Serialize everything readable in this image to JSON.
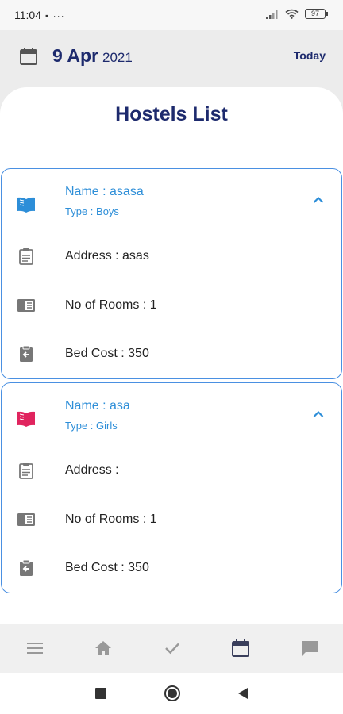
{
  "status_bar": {
    "time": "11:04",
    "left_icons": "▪ ···",
    "battery": "97"
  },
  "header": {
    "date_day": "9 Apr",
    "date_year": "2021",
    "today_label": "Today"
  },
  "page": {
    "title": "Hostels List"
  },
  "hostels": [
    {
      "name": "Name  : asasa",
      "type": "Type : Boys",
      "address": "Address : asas",
      "rooms": "No of Rooms : 1",
      "bed_cost": "Bed Cost : 350",
      "book_icon_color": "#2d8ed8"
    },
    {
      "name": "Name  : asa",
      "type": "Type : Girls",
      "address": "Address :",
      "rooms": "No of Rooms : 1",
      "bed_cost": "Bed Cost : 350",
      "book_icon_color": "#e0245e"
    }
  ],
  "bottom_nav": {
    "items": [
      "menu-icon",
      "home-icon",
      "check-icon",
      "calendar-icon",
      "chat-icon"
    ],
    "active": "calendar-icon"
  },
  "colors": {
    "accent": "#1d2a6d",
    "link_blue": "#2d8ed8",
    "card_border": "#4a90e2"
  }
}
